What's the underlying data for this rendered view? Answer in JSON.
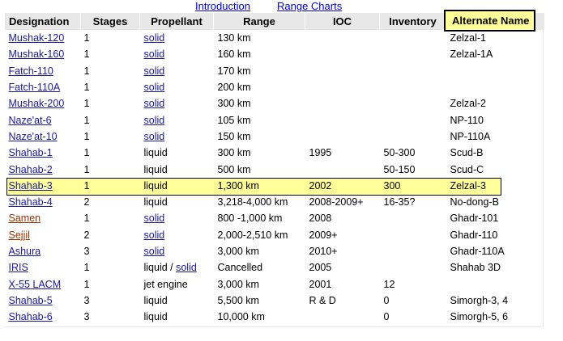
{
  "nav": {
    "introduction": "Introduction",
    "range_charts": "Range Charts"
  },
  "headers": {
    "designation": "Designation",
    "stages": "Stages",
    "propellant": "Propellant",
    "range": "Range",
    "ioc": "IOC",
    "inventory": "Inventory",
    "alternate_name": "Alternate Name"
  },
  "rows": [
    {
      "designation": "Mushak-120",
      "stages": "1",
      "propellant": "solid",
      "range": "130 km",
      "ioc": "",
      "inventory": "",
      "alt": "Zelzal-1"
    },
    {
      "designation": "Mushak-160",
      "stages": "1",
      "propellant": "solid",
      "range": "160 km",
      "ioc": "",
      "inventory": "",
      "alt": "Zelzal-1A"
    },
    {
      "designation": "Fatch-110",
      "stages": "1",
      "propellant": "solid",
      "range": "170 km",
      "ioc": "",
      "inventory": "",
      "alt": ""
    },
    {
      "designation": "Fatch-110A",
      "stages": "1",
      "propellant": "solid",
      "range": "200 km",
      "ioc": "",
      "inventory": "",
      "alt": ""
    },
    {
      "designation": "Mushak-200",
      "stages": "1",
      "propellant": "solid",
      "range": "300 km",
      "ioc": "",
      "inventory": "",
      "alt": "Zelzal-2"
    },
    {
      "designation": "Naze'at-6",
      "stages": "1",
      "propellant": "solid",
      "range": "105 km",
      "ioc": "",
      "inventory": "",
      "alt": "NP-110"
    },
    {
      "designation": "Naze'at-10",
      "stages": "1",
      "propellant": "solid",
      "range": "150 km",
      "ioc": "",
      "inventory": "",
      "alt": "NP-110A"
    },
    {
      "designation": "Shahab-1",
      "stages": "1",
      "propellant": "liquid",
      "range": "300 km",
      "ioc": "1995",
      "inventory": "50-300",
      "alt": "Scud-B"
    },
    {
      "designation": "Shahab-2",
      "stages": "1",
      "propellant": "liquid",
      "range": "500 km",
      "ioc": "",
      "inventory": "50-150",
      "alt": "Scud-C"
    },
    {
      "designation": "Shahab-3",
      "stages": "1",
      "propellant": "liquid",
      "range": "1,300 km",
      "ioc": "2002",
      "inventory": "300",
      "alt": "Zelzal-3"
    },
    {
      "designation": "Shahab-4",
      "stages": "2",
      "propellant": "liquid",
      "range": "3,218-4,000 km",
      "ioc": "2008-2009+",
      "inventory": "16-35?",
      "alt": "No-dong-B"
    },
    {
      "designation": "Samen",
      "stages": "1",
      "propellant": "solid",
      "range": "800 -1,000 km",
      "ioc": "2008",
      "inventory": "",
      "alt": "Ghadr-101"
    },
    {
      "designation": "Sejjil",
      "stages": "2",
      "propellant": "solid",
      "range": "2,000-2,510 km",
      "ioc": "2009+",
      "inventory": "",
      "alt": "Ghadr-110"
    },
    {
      "designation": "Ashura",
      "stages": "3",
      "propellant": "solid",
      "range": "3,000 km",
      "ioc": "2010+",
      "inventory": "",
      "alt": "Ghadr-110A"
    },
    {
      "designation": "IRIS",
      "stages": "1",
      "propellant": "liquid",
      "propellant_sep": " / ",
      "propellant_link": "solid",
      "range": "Cancelled",
      "ioc": "2005",
      "inventory": "",
      "alt": "Shahab 3D"
    },
    {
      "designation": "X-55 LACM",
      "stages": "1",
      "propellant": "jet engine",
      "range": "3,000 km",
      "ioc": "2001",
      "inventory": "12",
      "alt": ""
    },
    {
      "designation": "Shahab-5",
      "stages": "3",
      "propellant": "liquid",
      "range": "5,500 km",
      "ioc": "R & D",
      "inventory": "0",
      "alt": "Simorgh-3, 4"
    },
    {
      "designation": "Shahab-6",
      "stages": "3",
      "propellant": "liquid",
      "range": "10,000 km",
      "ioc": "",
      "inventory": "0",
      "alt": "Simorgh-5, 6"
    }
  ]
}
